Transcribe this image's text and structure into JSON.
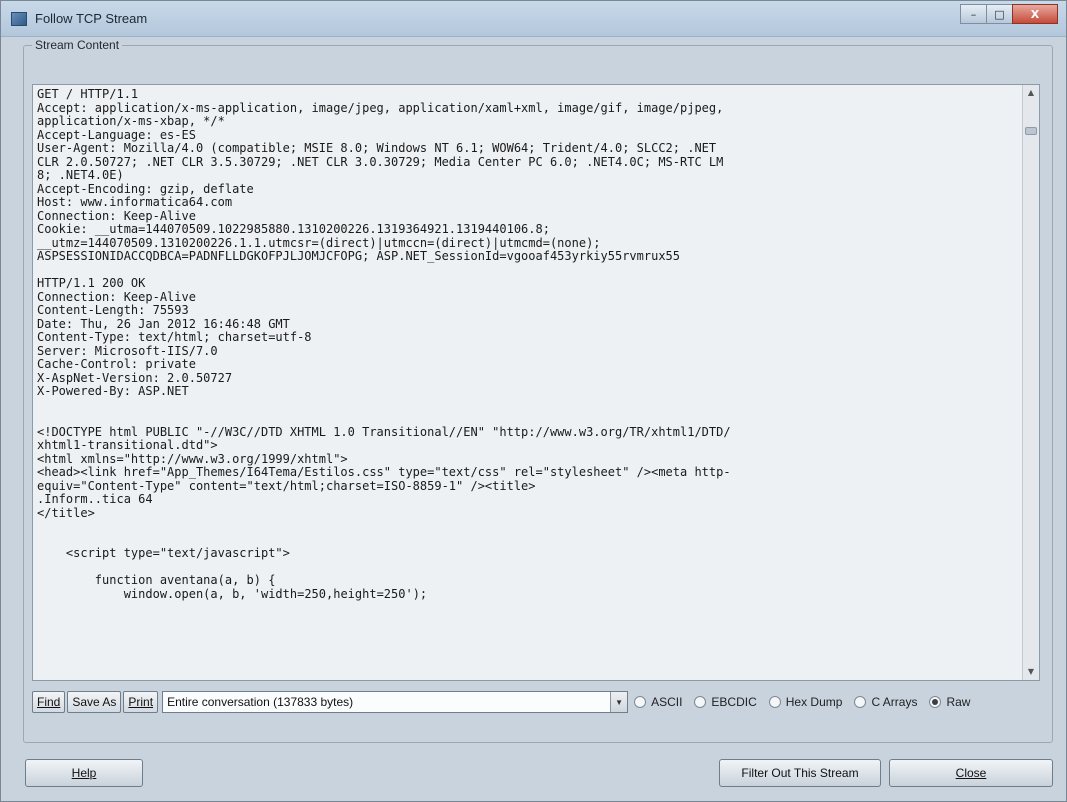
{
  "window": {
    "title": "Follow TCP Stream",
    "minimize_glyph": "–",
    "maximize_glyph": "□",
    "close_glyph": "X"
  },
  "stream": {
    "label": "Stream Content",
    "text": "GET / HTTP/1.1\nAccept: application/x-ms-application, image/jpeg, application/xaml+xml, image/gif, image/pjpeg,\napplication/x-ms-xbap, */*\nAccept-Language: es-ES\nUser-Agent: Mozilla/4.0 (compatible; MSIE 8.0; Windows NT 6.1; WOW64; Trident/4.0; SLCC2; .NET\nCLR 2.0.50727; .NET CLR 3.5.30729; .NET CLR 3.0.30729; Media Center PC 6.0; .NET4.0C; MS-RTC LM\n8; .NET4.0E)\nAccept-Encoding: gzip, deflate\nHost: www.informatica64.com\nConnection: Keep-Alive\nCookie: __utma=144070509.1022985880.1310200226.1319364921.1319440106.8;\n__utmz=144070509.1310200226.1.1.utmcsr=(direct)|utmccn=(direct)|utmcmd=(none);\nASPSESSIONIDACCQDBCA=PADNFLLDGKOFPJLJOMJCFOPG; ASP.NET_SessionId=vgooaf453yrkiy55rvmrux55\n\nHTTP/1.1 200 OK\nConnection: Keep-Alive\nContent-Length: 75593\nDate: Thu, 26 Jan 2012 16:46:48 GMT\nContent-Type: text/html; charset=utf-8\nServer: Microsoft-IIS/7.0\nCache-Control: private\nX-AspNet-Version: 2.0.50727\nX-Powered-By: ASP.NET\n\n\n<!DOCTYPE html PUBLIC \"-//W3C//DTD XHTML 1.0 Transitional//EN\" \"http://www.w3.org/TR/xhtml1/DTD/\nxhtml1-transitional.dtd\">\n<html xmlns=\"http://www.w3.org/1999/xhtml\">\n<head><link href=\"App_Themes/I64Tema/Estilos.css\" type=\"text/css\" rel=\"stylesheet\" /><meta http-\nequiv=\"Content-Type\" content=\"text/html;charset=ISO-8859-1\" /><title>\n.Inform..tica 64\n</title>\n\n\n    <script type=\"text/javascript\">\n\n        function aventana(a, b) {\n            window.open(a, b, 'width=250,height=250');"
  },
  "controls": {
    "find_label": "Find",
    "save_as_label": "Save As",
    "print_label": "Print",
    "conversation_select": "Entire conversation (137833 bytes)",
    "formats": [
      {
        "label": "ASCII",
        "checked": false
      },
      {
        "label": "EBCDIC",
        "checked": false
      },
      {
        "label": "Hex Dump",
        "checked": false
      },
      {
        "label": "C Arrays",
        "checked": false
      },
      {
        "label": "Raw",
        "checked": true
      }
    ]
  },
  "footer": {
    "help_label": "Help",
    "filter_label": "Filter Out This Stream",
    "close_label": "Close"
  }
}
